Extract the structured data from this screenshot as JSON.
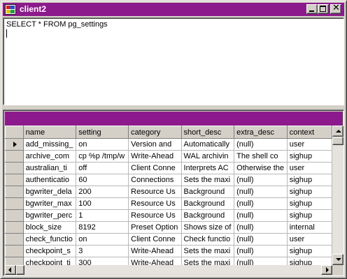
{
  "window": {
    "title": "client2"
  },
  "titlebar": {
    "close_glyph": "✕"
  },
  "editor": {
    "query": "SELECT * FROM pg_settings"
  },
  "grid": {
    "columns": [
      "name",
      "setting",
      "category",
      "short_desc",
      "extra_desc",
      "context"
    ],
    "current_row_indicator": "row-pointer-icon",
    "rows": [
      [
        "add_missing_",
        "on",
        "Version and",
        "Automatically",
        "(null)",
        "user"
      ],
      [
        "archive_com",
        "cp %p /tmp/w",
        "Write-Ahead",
        "WAL archivin",
        "The shell co",
        "sighup"
      ],
      [
        "australian_ti",
        "off",
        "Client Conne",
        "Interprets AC",
        "Otherwise the",
        "user"
      ],
      [
        "authenticatio",
        "60",
        "Connections",
        "Sets the maxi",
        "(null)",
        "sighup"
      ],
      [
        "bgwriter_dela",
        "200",
        "Resource Us",
        "Background",
        "(null)",
        "sighup"
      ],
      [
        "bgwriter_max",
        "100",
        "Resource Us",
        "Background",
        "(null)",
        "sighup"
      ],
      [
        "bgwriter_perc",
        "1",
        "Resource Us",
        "Background",
        "(null)",
        "sighup"
      ],
      [
        "block_size",
        "8192",
        "Preset Option",
        "Shows size of",
        "(null)",
        "internal"
      ],
      [
        "check_functio",
        "on",
        "Client Conne",
        "Check functio",
        "(null)",
        "user"
      ],
      [
        "checkpoint_s",
        "3",
        "Write-Ahead",
        "Sets the maxi",
        "(null)",
        "sighup"
      ],
      [
        "checkpoint_ti",
        "300",
        "Write-Ahead",
        "Sets the maxi",
        "(null)",
        "sighup"
      ]
    ]
  },
  "colors": {
    "titlebar": "#8c1a8c",
    "grid_caption": "#8c1a8c",
    "chrome": "#d4d0c8",
    "scroll_track": "#e6e3de"
  },
  "icons": [
    "app-icon",
    "minimize-icon",
    "maximize-icon",
    "close-icon",
    "row-pointer-icon",
    "scroll-up-icon",
    "scroll-down-icon",
    "scroll-left-icon",
    "scroll-right-icon"
  ]
}
